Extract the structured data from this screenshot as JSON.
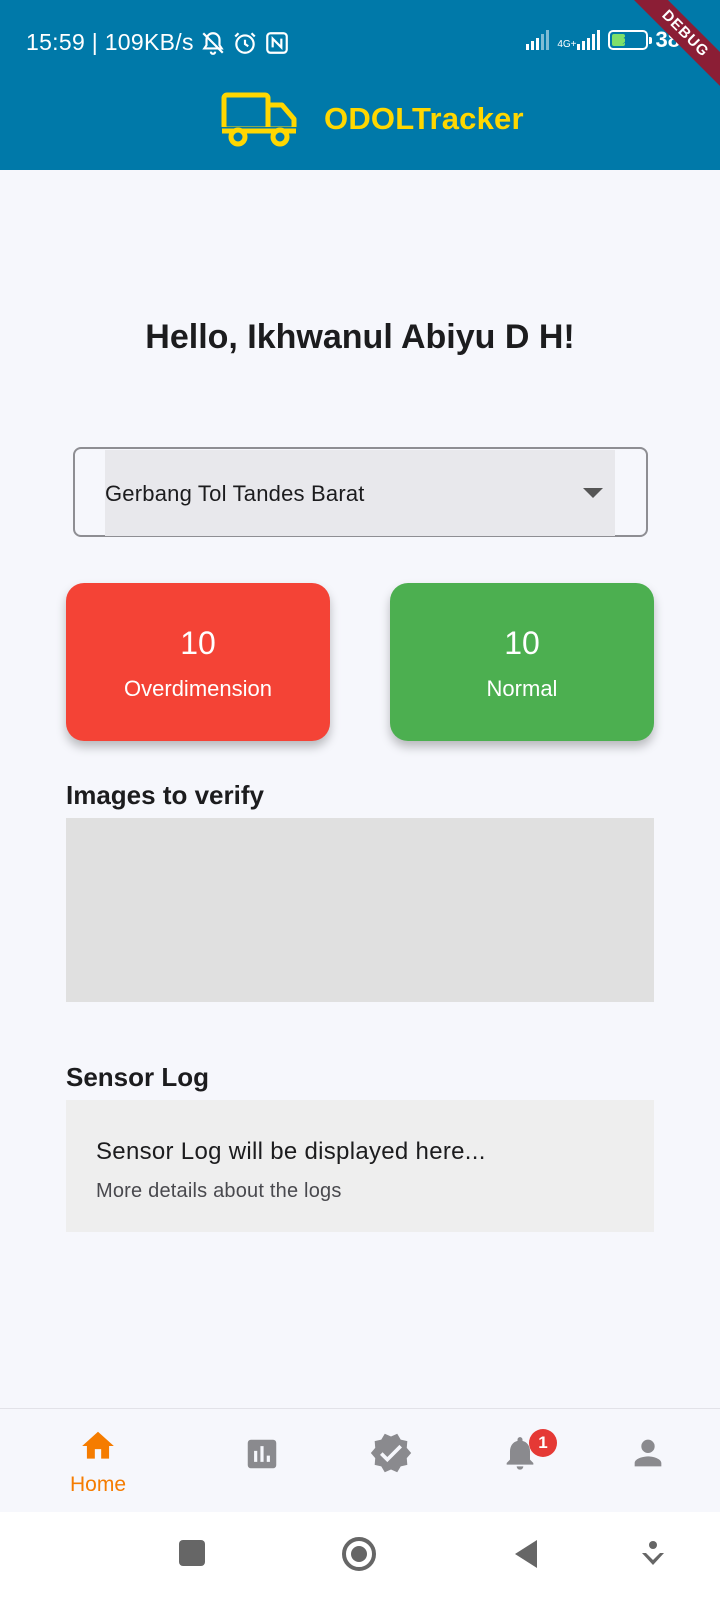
{
  "status_bar": {
    "time_speed": "15:59 | 109KB/s",
    "network": "4G+",
    "battery": "38",
    "battery_level": 0.38
  },
  "debug_banner": "DEBUG",
  "app": {
    "title": "ODOLTracker",
    "logo_icon": "truck-icon",
    "brand_color": "#0079a9",
    "accent_color": "#ffd700"
  },
  "greeting": "Hello, Ikhwanul Abiyu D H!",
  "location_select": {
    "selected": "Gerbang Tol Tandes Barat"
  },
  "stats": {
    "overdimension": {
      "count": "10",
      "label": "Overdimension",
      "color": "#f44336"
    },
    "normal": {
      "count": "10",
      "label": "Normal",
      "color": "#4caf50"
    }
  },
  "images_section": {
    "title": "Images to verify"
  },
  "sensor_log": {
    "title": "Sensor Log",
    "main_text": "Sensor Log will be displayed here...",
    "sub_text": "More details about the logs"
  },
  "bottom_nav": {
    "active_color": "#f57c00",
    "items": [
      {
        "label": "Home",
        "icon": "home-icon",
        "active": true
      },
      {
        "label": "",
        "icon": "bar-chart-icon",
        "active": false
      },
      {
        "label": "",
        "icon": "verified-icon",
        "active": false
      },
      {
        "label": "",
        "icon": "bell-icon",
        "badge": "1",
        "active": false
      },
      {
        "label": "",
        "icon": "person-icon",
        "active": false
      }
    ]
  }
}
